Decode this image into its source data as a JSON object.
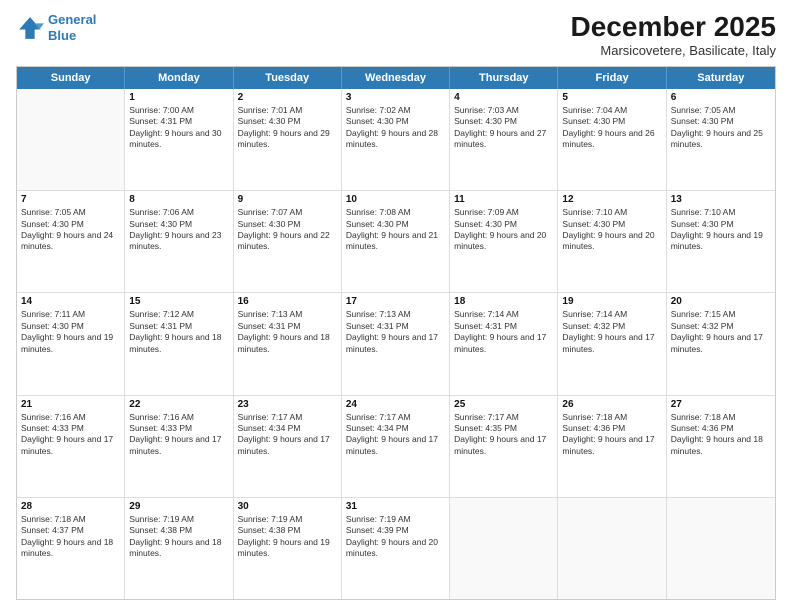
{
  "logo": {
    "line1": "General",
    "line2": "Blue"
  },
  "title": "December 2025",
  "location": "Marsicovetere, Basilicate, Italy",
  "days": [
    "Sunday",
    "Monday",
    "Tuesday",
    "Wednesday",
    "Thursday",
    "Friday",
    "Saturday"
  ],
  "weeks": [
    [
      {
        "day": "",
        "sunrise": "",
        "sunset": "",
        "daylight": ""
      },
      {
        "day": "1",
        "sunrise": "Sunrise: 7:00 AM",
        "sunset": "Sunset: 4:31 PM",
        "daylight": "Daylight: 9 hours and 30 minutes."
      },
      {
        "day": "2",
        "sunrise": "Sunrise: 7:01 AM",
        "sunset": "Sunset: 4:30 PM",
        "daylight": "Daylight: 9 hours and 29 minutes."
      },
      {
        "day": "3",
        "sunrise": "Sunrise: 7:02 AM",
        "sunset": "Sunset: 4:30 PM",
        "daylight": "Daylight: 9 hours and 28 minutes."
      },
      {
        "day": "4",
        "sunrise": "Sunrise: 7:03 AM",
        "sunset": "Sunset: 4:30 PM",
        "daylight": "Daylight: 9 hours and 27 minutes."
      },
      {
        "day": "5",
        "sunrise": "Sunrise: 7:04 AM",
        "sunset": "Sunset: 4:30 PM",
        "daylight": "Daylight: 9 hours and 26 minutes."
      },
      {
        "day": "6",
        "sunrise": "Sunrise: 7:05 AM",
        "sunset": "Sunset: 4:30 PM",
        "daylight": "Daylight: 9 hours and 25 minutes."
      }
    ],
    [
      {
        "day": "7",
        "sunrise": "Sunrise: 7:05 AM",
        "sunset": "Sunset: 4:30 PM",
        "daylight": "Daylight: 9 hours and 24 minutes."
      },
      {
        "day": "8",
        "sunrise": "Sunrise: 7:06 AM",
        "sunset": "Sunset: 4:30 PM",
        "daylight": "Daylight: 9 hours and 23 minutes."
      },
      {
        "day": "9",
        "sunrise": "Sunrise: 7:07 AM",
        "sunset": "Sunset: 4:30 PM",
        "daylight": "Daylight: 9 hours and 22 minutes."
      },
      {
        "day": "10",
        "sunrise": "Sunrise: 7:08 AM",
        "sunset": "Sunset: 4:30 PM",
        "daylight": "Daylight: 9 hours and 21 minutes."
      },
      {
        "day": "11",
        "sunrise": "Sunrise: 7:09 AM",
        "sunset": "Sunset: 4:30 PM",
        "daylight": "Daylight: 9 hours and 20 minutes."
      },
      {
        "day": "12",
        "sunrise": "Sunrise: 7:10 AM",
        "sunset": "Sunset: 4:30 PM",
        "daylight": "Daylight: 9 hours and 20 minutes."
      },
      {
        "day": "13",
        "sunrise": "Sunrise: 7:10 AM",
        "sunset": "Sunset: 4:30 PM",
        "daylight": "Daylight: 9 hours and 19 minutes."
      }
    ],
    [
      {
        "day": "14",
        "sunrise": "Sunrise: 7:11 AM",
        "sunset": "Sunset: 4:30 PM",
        "daylight": "Daylight: 9 hours and 19 minutes."
      },
      {
        "day": "15",
        "sunrise": "Sunrise: 7:12 AM",
        "sunset": "Sunset: 4:31 PM",
        "daylight": "Daylight: 9 hours and 18 minutes."
      },
      {
        "day": "16",
        "sunrise": "Sunrise: 7:13 AM",
        "sunset": "Sunset: 4:31 PM",
        "daylight": "Daylight: 9 hours and 18 minutes."
      },
      {
        "day": "17",
        "sunrise": "Sunrise: 7:13 AM",
        "sunset": "Sunset: 4:31 PM",
        "daylight": "Daylight: 9 hours and 17 minutes."
      },
      {
        "day": "18",
        "sunrise": "Sunrise: 7:14 AM",
        "sunset": "Sunset: 4:31 PM",
        "daylight": "Daylight: 9 hours and 17 minutes."
      },
      {
        "day": "19",
        "sunrise": "Sunrise: 7:14 AM",
        "sunset": "Sunset: 4:32 PM",
        "daylight": "Daylight: 9 hours and 17 minutes."
      },
      {
        "day": "20",
        "sunrise": "Sunrise: 7:15 AM",
        "sunset": "Sunset: 4:32 PM",
        "daylight": "Daylight: 9 hours and 17 minutes."
      }
    ],
    [
      {
        "day": "21",
        "sunrise": "Sunrise: 7:16 AM",
        "sunset": "Sunset: 4:33 PM",
        "daylight": "Daylight: 9 hours and 17 minutes."
      },
      {
        "day": "22",
        "sunrise": "Sunrise: 7:16 AM",
        "sunset": "Sunset: 4:33 PM",
        "daylight": "Daylight: 9 hours and 17 minutes."
      },
      {
        "day": "23",
        "sunrise": "Sunrise: 7:17 AM",
        "sunset": "Sunset: 4:34 PM",
        "daylight": "Daylight: 9 hours and 17 minutes."
      },
      {
        "day": "24",
        "sunrise": "Sunrise: 7:17 AM",
        "sunset": "Sunset: 4:34 PM",
        "daylight": "Daylight: 9 hours and 17 minutes."
      },
      {
        "day": "25",
        "sunrise": "Sunrise: 7:17 AM",
        "sunset": "Sunset: 4:35 PM",
        "daylight": "Daylight: 9 hours and 17 minutes."
      },
      {
        "day": "26",
        "sunrise": "Sunrise: 7:18 AM",
        "sunset": "Sunset: 4:36 PM",
        "daylight": "Daylight: 9 hours and 17 minutes."
      },
      {
        "day": "27",
        "sunrise": "Sunrise: 7:18 AM",
        "sunset": "Sunset: 4:36 PM",
        "daylight": "Daylight: 9 hours and 18 minutes."
      }
    ],
    [
      {
        "day": "28",
        "sunrise": "Sunrise: 7:18 AM",
        "sunset": "Sunset: 4:37 PM",
        "daylight": "Daylight: 9 hours and 18 minutes."
      },
      {
        "day": "29",
        "sunrise": "Sunrise: 7:19 AM",
        "sunset": "Sunset: 4:38 PM",
        "daylight": "Daylight: 9 hours and 18 minutes."
      },
      {
        "day": "30",
        "sunrise": "Sunrise: 7:19 AM",
        "sunset": "Sunset: 4:38 PM",
        "daylight": "Daylight: 9 hours and 19 minutes."
      },
      {
        "day": "31",
        "sunrise": "Sunrise: 7:19 AM",
        "sunset": "Sunset: 4:39 PM",
        "daylight": "Daylight: 9 hours and 20 minutes."
      },
      {
        "day": "",
        "sunrise": "",
        "sunset": "",
        "daylight": ""
      },
      {
        "day": "",
        "sunrise": "",
        "sunset": "",
        "daylight": ""
      },
      {
        "day": "",
        "sunrise": "",
        "sunset": "",
        "daylight": ""
      }
    ]
  ]
}
